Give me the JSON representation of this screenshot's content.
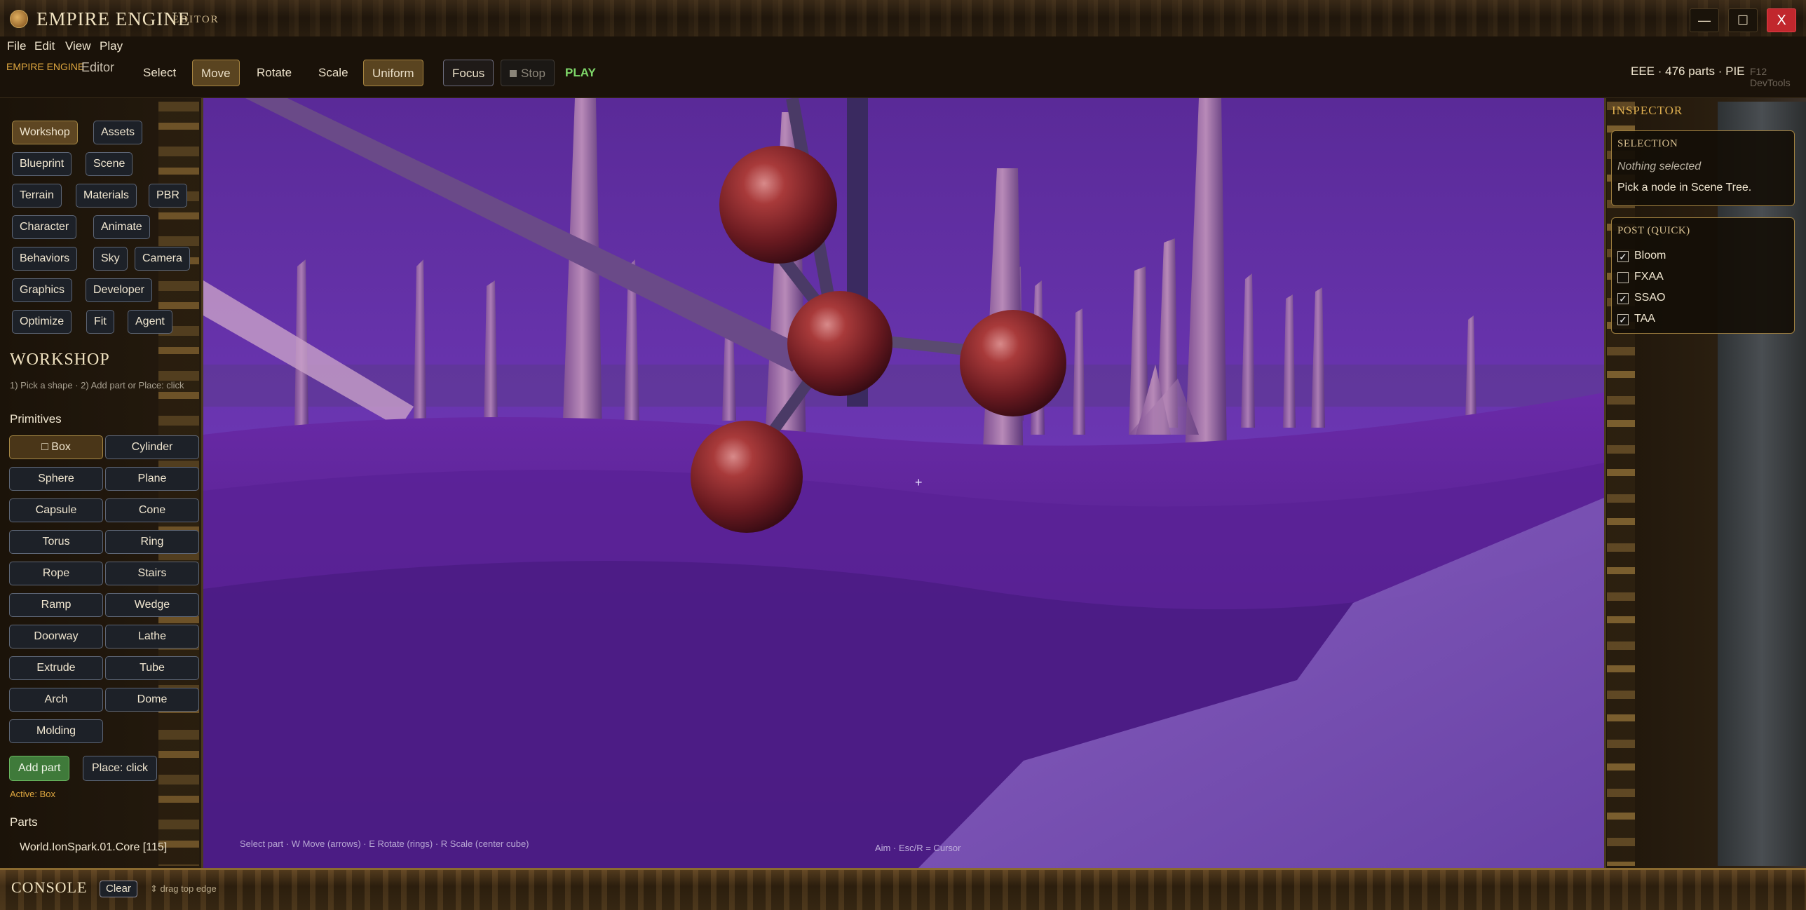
{
  "window": {
    "title": "EMPIRE ENGINE",
    "subtitle": "EDITOR",
    "minimize": "—",
    "maximize": "☐",
    "close": "X"
  },
  "menu": [
    "File",
    "Edit",
    "View",
    "Play"
  ],
  "toolbar": {
    "brand": "EMPIRE ENGINE",
    "mode": "Editor",
    "select": "Select",
    "move": "Move",
    "rotate": "Rotate",
    "scale": "Scale",
    "uniform": "Uniform",
    "focus": "Focus",
    "stop": "Stop",
    "play": "PLAY",
    "status": "EEE · 476 parts · PIE",
    "devtools": "F12 DevTools"
  },
  "nav": {
    "workshop": "Workshop",
    "assets": "Assets",
    "blueprint": "Blueprint",
    "scene": "Scene",
    "terrain": "Terrain",
    "materials": "Materials",
    "pbr": "PBR",
    "character": "Character",
    "animate": "Animate",
    "behaviors": "Behaviors",
    "sky": "Sky",
    "camera": "Camera",
    "graphics": "Graphics",
    "developer": "Developer",
    "optimize": "Optimize",
    "fit": "Fit",
    "agent": "Agent"
  },
  "workshop": {
    "title": "WORKSHOP",
    "hint": "1) Pick a shape · 2) Add part or Place: click",
    "primitives_title": "Primitives",
    "primitives": {
      "box": "□ Box",
      "cylinder": "Cylinder",
      "sphere": "Sphere",
      "plane": "Plane",
      "capsule": "Capsule",
      "cone": "Cone",
      "torus": "Torus",
      "ring": "Ring",
      "rope": "Rope",
      "stairs": "Stairs",
      "ramp": "Ramp",
      "wedge": "Wedge",
      "doorway": "Doorway",
      "lathe": "Lathe",
      "extrude": "Extrude",
      "tube": "Tube",
      "arch": "Arch",
      "dome": "Dome",
      "molding": "Molding"
    },
    "add_part": "Add part",
    "place_click": "Place: click",
    "active": "Active: Box",
    "parts_title": "Parts",
    "parts_item": "World.IonSpark.01.Core  [115]"
  },
  "viewport": {
    "hint_left": "Select part · W Move (arrows) · E Rotate (rings) · R Scale (center cube)",
    "hint_center": "Aim · Esc/R = Cursor",
    "crosshair": "+"
  },
  "inspector": {
    "title": "INSPECTOR",
    "selection_title": "SELECTION",
    "nothing_selected": "Nothing selected",
    "pick_node": "Pick a node in Scene Tree.",
    "post_title": "POST (QUICK)",
    "post": {
      "bloom": "Bloom",
      "fxaa": "FXAA",
      "ssao": "SSAO",
      "taa": "TAA"
    },
    "post_checked": {
      "bloom": true,
      "fxaa": false,
      "ssao": true,
      "taa": true
    }
  },
  "console": {
    "title": "CONSOLE",
    "clear": "Clear",
    "hint": "⇕ drag top edge"
  },
  "colors": {
    "accent_gold": "#e0a840",
    "play_green": "#7fd86a",
    "close_red": "#c1272d",
    "viewport_purple": "#6a32b0"
  }
}
